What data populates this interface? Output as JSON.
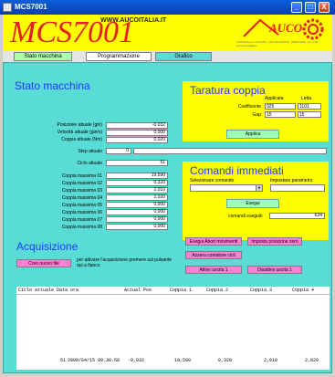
{
  "window": {
    "title": "MCS7001",
    "minimize": "_",
    "maximize": "□",
    "close": "X"
  },
  "header": {
    "app_name": "MCS7001",
    "site": "WWW.AUCOITALIA.IT",
    "brand": "AUCO",
    "brand_subtitle": "Automazione e Controllo - Via dell'Industria - 00000 Italia - tel. e fax - www.aucoitalia.it"
  },
  "tabs": [
    "Stato macchina",
    "Programmazione",
    "Grafico"
  ],
  "stato": {
    "title": "Stato macchina",
    "rows": [
      {
        "label": "Posizione attuale (gin)",
        "value": "-0,032"
      },
      {
        "label": "Velocità attuale (gin/s)",
        "value": "0,000"
      },
      {
        "label": "Coppia attuale (Nm)",
        "value": "0,020"
      }
    ],
    "step_label": "Step attuale",
    "step_value": "0",
    "ciclo_label": "Ciclo attuale",
    "ciclo_value": "51",
    "coppie": [
      {
        "label": "Coppia massima 01",
        "value": "19,590"
      },
      {
        "label": "Coppia massima 02",
        "value": "0,320"
      },
      {
        "label": "Coppia massima 03",
        "value": "2,010"
      },
      {
        "label": "Coppia massima 04",
        "value": "2,020"
      },
      {
        "label": "Coppia massima 05",
        "value": "0,000"
      },
      {
        "label": "Coppia massima 06",
        "value": "0,000"
      },
      {
        "label": "Coppia massima 07",
        "value": "0,000"
      },
      {
        "label": "Coppia massima 08",
        "value": "0,000"
      }
    ]
  },
  "taratura": {
    "title": "Taratura coppia",
    "col_applicata": "Applicata",
    "col_letta": "Letta",
    "coeff_label": "Coefficente",
    "coeff_applicata": "925",
    "coeff_letta": "1101",
    "gap_label": "Gap",
    "gap_applicata": "15",
    "gap_letta": "15",
    "apply_button": "Applica"
  },
  "comandi": {
    "title": "Comandi immediati",
    "select_label": "Selezionare comando",
    "param_label": "Impostare parametro",
    "select_value": "",
    "param_value": "",
    "esegui_button": "Esegui",
    "eseguiti_label": "comandi eseguiti",
    "eseguiti_value": "634",
    "buttons": [
      "Esegui Abort movimenti",
      "Imposta posizione zero",
      "Azzera contatore cicli",
      "Attivo uscita 1",
      "Disattivo uscita 1"
    ]
  },
  "acquisizione": {
    "title": "Acquisizione",
    "new_file_button": "Creo nuovo file",
    "hint": "per attivare l'acquisizione premere sul pulsante qui a fianco"
  },
  "table": {
    "headers": [
      "Ciclo attuale",
      "Data ora",
      "Actual Pos",
      "Coppia 1",
      "Coppia 2",
      "Coppia 3",
      "Coppia 4"
    ],
    "rows": [
      [
        "51",
        "2008/04/15 09.30.58",
        "-0,032",
        "19,590",
        "0,320",
        "2,010",
        "2,020"
      ]
    ]
  }
}
